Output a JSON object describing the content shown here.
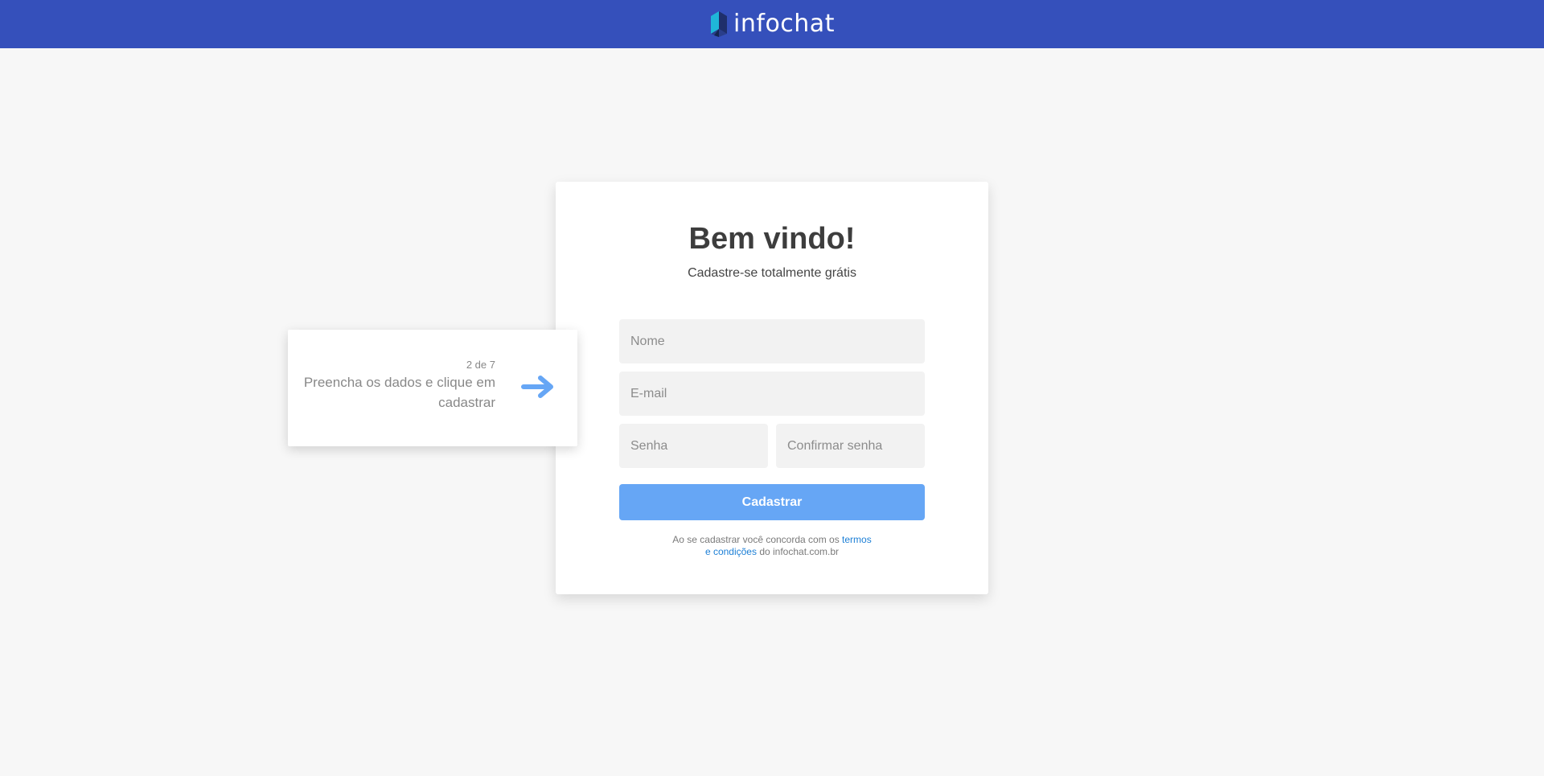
{
  "header": {
    "logo_text": "infochat",
    "background_color": "#3550bb"
  },
  "card": {
    "title": "Bem vindo!",
    "subtitle": "Cadastre-se totalmente grátis",
    "fields": {
      "nome_placeholder": "Nome",
      "email_placeholder": "E-mail",
      "senha_placeholder": "Senha",
      "confirmar_placeholder": "Confirmar senha"
    },
    "submit_label": "Cadastrar",
    "submit_color": "#66a6f5",
    "terms": {
      "prefix": "Ao se cadastrar você concorda com os ",
      "link_line1": "termos",
      "link_line2": "e condições",
      "suffix": " do infochat.com.br",
      "link_color": "#1c7fd6"
    }
  },
  "tour_tip": {
    "step": "2 de 7",
    "message": "Preencha os dados e clique em cadastrar",
    "arrow_icon": "arrow-right-icon",
    "arrow_color": "#66a6f5"
  }
}
